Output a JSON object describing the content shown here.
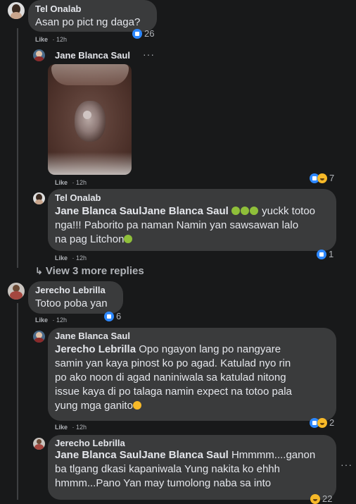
{
  "comments": [
    {
      "author": "Tel Onalab",
      "text": "Asan po pict ng daga?",
      "like_label": "Like",
      "time": "12h",
      "reaction_count": "26"
    },
    {
      "author": "Jane Blanca Saul",
      "like_label": "Like",
      "time": "12h",
      "reaction_count": "7"
    },
    {
      "author": "Tel Onalab",
      "mention": "Jane Blanca SaulJane Blanca Saul",
      "text_a": " yuckk totoo",
      "text_b": "nga!!! Paborito pa naman Namin yan sawsawan lalo",
      "text_c": "na pag Litchon",
      "like_label": "Like",
      "time": "12h",
      "reaction_count": "1"
    },
    {
      "author": "Jerecho Lebrilla",
      "text": "Totoo poba yan",
      "like_label": "Like",
      "time": "12h",
      "reaction_count": "6"
    },
    {
      "author": "Jane Blanca Saul",
      "mention": "Jerecho Lebrilla",
      "lines": [
        " Opo ngayon lang po nangyare",
        "samin yan kaya pinost ko po agad. Katulad nyo rin",
        "po ako noon di agad naniniwala sa katulad nitong",
        "issue kaya di po talaga namin expect na totoo pala",
        "yung mga ganito"
      ],
      "like_label": "Like",
      "time": "12h",
      "reaction_count": "2"
    },
    {
      "author": "Jerecho Lebrilla",
      "mention": "Jane Blanca SaulJane Blanca Saul",
      "lines": [
        " Hmmmm....ganon",
        "ba tlgang dkasi kapaniwala Yung nakita ko ehhh",
        "hmmm...Pano Yan may tumolong naba sa into"
      ],
      "reaction_count": "22"
    }
  ],
  "view_more": "View 3 more replies",
  "more_options": "···",
  "icons": {
    "reply_arrow": "reply-arrow-icon",
    "like": "like-reaction-icon",
    "haha": "haha-reaction-icon"
  }
}
